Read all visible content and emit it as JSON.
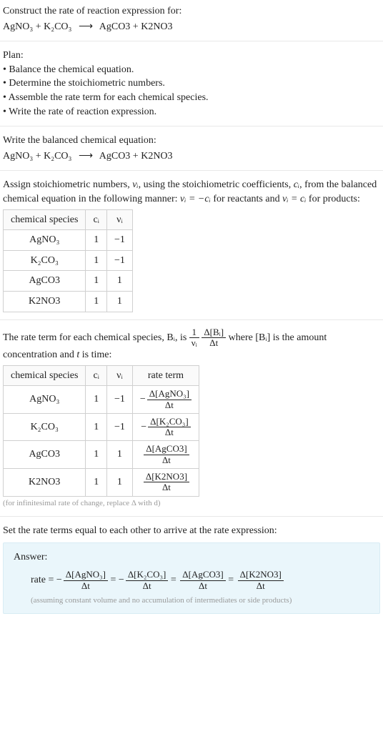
{
  "intro": {
    "line1": "Construct the rate of reaction expression for:",
    "reactants": "AgNO₃ + K₂CO₃",
    "arrow": "⟶",
    "products": "AgCO3 + K2NO3"
  },
  "plan": {
    "heading": "Plan:",
    "items": [
      "Balance the chemical equation.",
      "Determine the stoichiometric numbers.",
      "Assemble the rate term for each chemical species.",
      "Write the rate of reaction expression."
    ]
  },
  "balanced": {
    "heading": "Write the balanced chemical equation:",
    "reactants": "AgNO₃ + K₂CO₃",
    "arrow": "⟶",
    "products": "AgCO3 + K2NO3"
  },
  "assign": {
    "text_a": "Assign stoichiometric numbers, ",
    "nu_i": "νᵢ",
    "text_b": ", using the stoichiometric coefficients, ",
    "c_i": "cᵢ",
    "text_c": ", from the balanced chemical equation in the following manner: ",
    "rel_reactants": "νᵢ = −cᵢ",
    "text_d": " for reactants and ",
    "rel_products": "νᵢ = cᵢ",
    "text_e": " for products:"
  },
  "table1": {
    "headers": [
      "chemical species",
      "cᵢ",
      "νᵢ"
    ],
    "rows": [
      {
        "sp": "AgNO₃",
        "c": "1",
        "nu": "−1"
      },
      {
        "sp": "K₂CO₃",
        "c": "1",
        "nu": "−1"
      },
      {
        "sp": "AgCO3",
        "c": "1",
        "nu": "1"
      },
      {
        "sp": "K2NO3",
        "c": "1",
        "nu": "1"
      }
    ]
  },
  "rateterm": {
    "text_a": "The rate term for each chemical species, Bᵢ, is ",
    "frac1_num": "1",
    "frac1_den": "νᵢ",
    "frac2_num": "Δ[Bᵢ]",
    "frac2_den": "Δt",
    "text_b": " where [Bᵢ] is the amount concentration and ",
    "t": "t",
    "text_c": " is time:"
  },
  "table2": {
    "headers": [
      "chemical species",
      "cᵢ",
      "νᵢ",
      "rate term"
    ],
    "rows": [
      {
        "sp": "AgNO₃",
        "c": "1",
        "nu": "−1",
        "sign": "−",
        "num": "Δ[AgNO₃]",
        "den": "Δt"
      },
      {
        "sp": "K₂CO₃",
        "c": "1",
        "nu": "−1",
        "sign": "−",
        "num": "Δ[K₂CO₃]",
        "den": "Δt"
      },
      {
        "sp": "AgCO3",
        "c": "1",
        "nu": "1",
        "sign": "",
        "num": "Δ[AgCO3]",
        "den": "Δt"
      },
      {
        "sp": "K2NO3",
        "c": "1",
        "nu": "1",
        "sign": "",
        "num": "Δ[K2NO3]",
        "den": "Δt"
      }
    ]
  },
  "note_infinitesimal": "(for infinitesimal rate of change, replace Δ with d)",
  "setequal": "Set the rate terms equal to each other to arrive at the rate expression:",
  "answer": {
    "label": "Answer:",
    "prefix": "rate = ",
    "terms": [
      {
        "sign": "−",
        "num": "Δ[AgNO₃]",
        "den": "Δt"
      },
      {
        "sign": "−",
        "num": "Δ[K₂CO₃]",
        "den": "Δt"
      },
      {
        "sign": "",
        "num": "Δ[AgCO3]",
        "den": "Δt"
      },
      {
        "sign": "",
        "num": "Δ[K2NO3]",
        "den": "Δt"
      }
    ],
    "eq": " = ",
    "caveat": "(assuming constant volume and no accumulation of intermediates or side products)"
  }
}
